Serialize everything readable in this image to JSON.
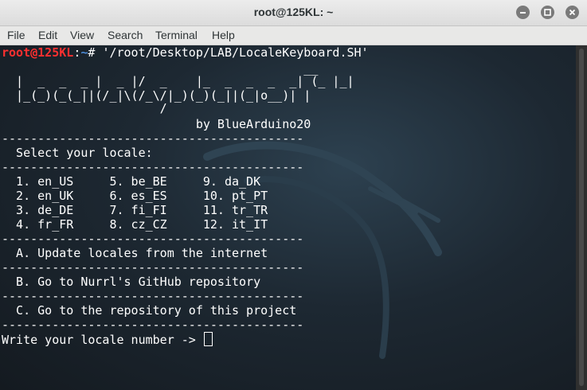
{
  "window": {
    "title": "root@125KL: ~"
  },
  "menu": {
    "file": "File",
    "edit": "Edit",
    "view": "View",
    "search": "Search",
    "terminal": "Terminal",
    "help": "Help"
  },
  "terminal": {
    "prompt_user": "root@125KL",
    "prompt_sep": ":",
    "prompt_path": "~",
    "prompt_symbol": "# ",
    "command": "'/root/Desktop/LAB/LocaleKeyboard.SH'",
    "banner": [
      "                                          __",
      "  |  _  _  _ |  _ |/  _    |_  _  _  _  _| (_ |_|",
      "  |_(_)(_(_||(/_|\\(/_\\/|_)(_)(_||(_|o__)| |",
      "                      /"
    ],
    "byline": "                           by BlueArduino20",
    "separator": "------------------------------------------",
    "select_heading": "  Select your locale:",
    "locale_rows": [
      "  1. en_US     5. be_BE     9. da_DK",
      "  2. en_UK     6. es_ES     10. pt_PT",
      "  3. de_DE     7. fi_FI     11. tr_TR",
      "  4. fr_FR     8. cz_CZ     12. it_IT"
    ],
    "option_a": "  A. Update locales from the internet",
    "option_b": "  B. Go to Nurrl's GitHub repository",
    "option_c": "  C. Go to the repository of this project",
    "input_prompt": "Write your locale number -> "
  },
  "colors": {
    "prompt_user": "#ff3030",
    "prompt_path": "#4d8bd6",
    "terminal_text": "#ffffff"
  }
}
